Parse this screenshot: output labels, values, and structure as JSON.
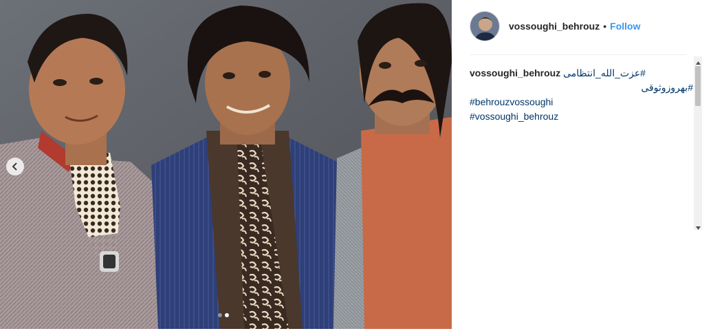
{
  "post": {
    "username": "vossoughi_behrouz",
    "separator": "•",
    "follow_label": "Follow",
    "caption": {
      "username": "vossoughi_behrouz",
      "lines": [
        "#عزت_الله_انتظامی",
        "#بهروزوثوقی",
        "#behrouzvossoughi",
        "#vossoughi_behrouz"
      ]
    }
  },
  "carousel": {
    "current": 2,
    "total": 2
  },
  "icons": {
    "prev": "chevron-left-icon",
    "scroll_up": "triangle-up-icon",
    "scroll_down": "triangle-down-icon"
  },
  "colors": {
    "link": "#3897f0",
    "hashtag": "#003569",
    "text": "#262626"
  }
}
